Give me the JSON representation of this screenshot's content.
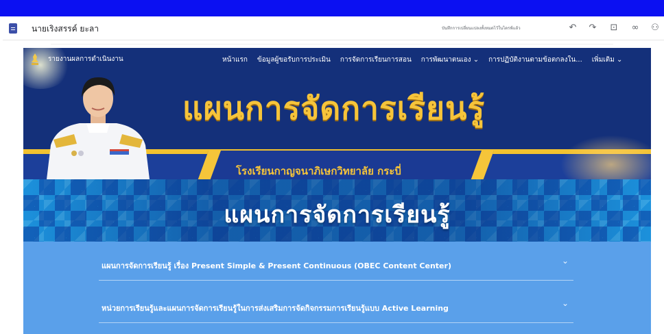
{
  "doc": {
    "title": "นายเริงสรรค์ ยะลา",
    "save_status": "บันทึกการเปลี่ยนแปลงทั้งหมดไว้ในไดรฟ์แล้ว"
  },
  "toolbar": {
    "icons": [
      "undo-icon",
      "redo-icon",
      "preview-icon",
      "link-icon",
      "share-icon"
    ],
    "glyphs": {
      "undo": "↶",
      "redo": "↷",
      "preview": "⊡",
      "link": "∞",
      "share": "⚇"
    }
  },
  "site": {
    "title": "รายงานผลการดำเนินงาน",
    "nav": [
      "หน้าแรก",
      "ข้อมูลผู้ขอรับการประเมิน",
      "การจัดการเรียนการสอน",
      "การพัฒนาตนเอง ⌄",
      "การปฏิบัติงานตามข้อตกลงใน...",
      "เพิ่มเติม ⌄"
    ],
    "hero_heading": "แผนการจัดการเรียนรู้",
    "school_name": "โรงเรียนกาญจนาภิเษกวิทยาลัย กระบี่",
    "section_heading": "แผนการจัดการเรียนรู้"
  },
  "accordion": [
    {
      "label": "แผนการจัดการเรียนรู้ เรื่อง Present Simple & Present Continuous (OBEC Content Center)",
      "chevron": "⌄"
    },
    {
      "label": "หน่วยการเรียนรู้และแผนการจัดการเรียนรู้ในการส่งเสริมการจัดกิจกรรมการเรียนรู้แบบ Active Learning",
      "chevron": "⌄"
    }
  ],
  "colors": {
    "topbar": "#0b10f2",
    "hero": "#14307a",
    "gold": "#f6c43a",
    "accordion": "#5aa0ea"
  }
}
